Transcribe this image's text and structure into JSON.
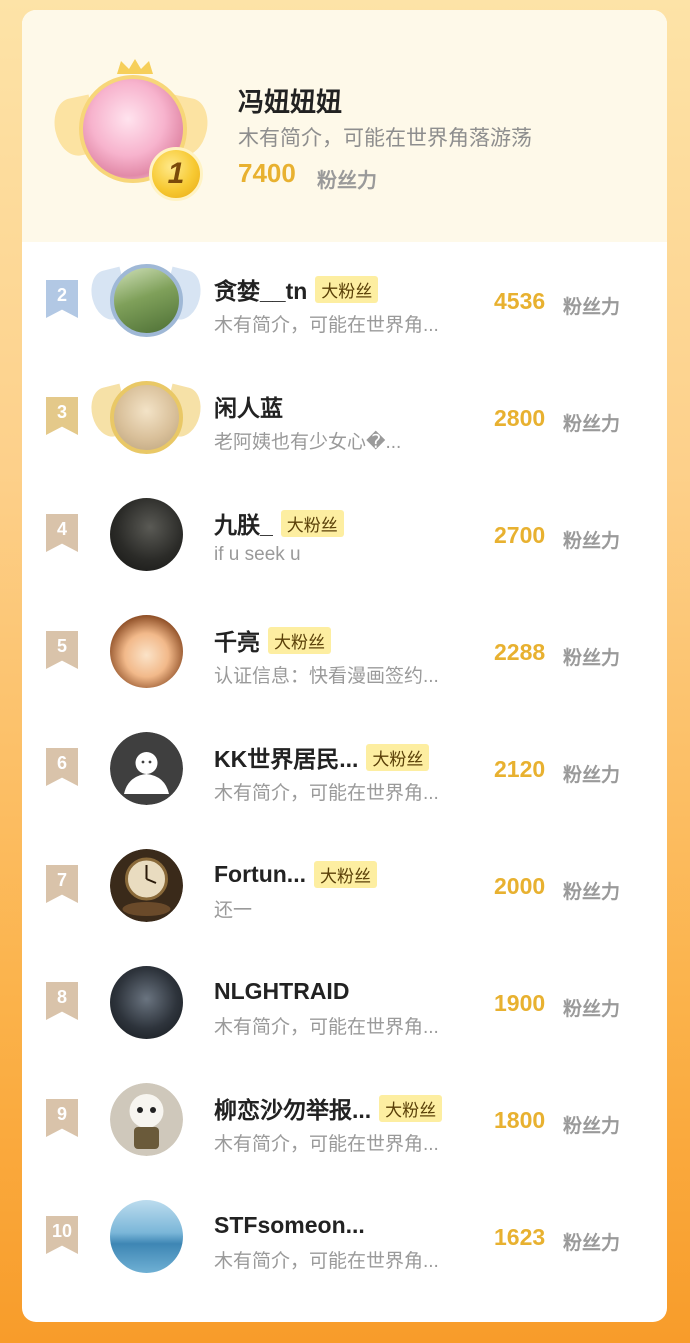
{
  "top": {
    "rank": "1",
    "name": "冯妞妞妞",
    "bio": "木有简介，可能在世界角落游荡",
    "score": "7400",
    "unit": "粉丝力"
  },
  "badge_label": "大粉丝",
  "unit": "粉丝力",
  "rows": [
    {
      "rank": "2",
      "name": "贪婪__tn",
      "badge": "大粉丝",
      "bio": "木有简介，可能在世界角...",
      "score": "4536"
    },
    {
      "rank": "3",
      "name": "闲人蓝",
      "badge": "",
      "bio": "老阿姨也有少女心�...",
      "score": "2800"
    },
    {
      "rank": "4",
      "name": "九朕_",
      "badge": "大粉丝",
      "bio": "if u seek u",
      "score": "2700"
    },
    {
      "rank": "5",
      "name": "千亮",
      "badge": "大粉丝",
      "bio": "认证信息：快看漫画签约...",
      "score": "2288"
    },
    {
      "rank": "6",
      "name": "KK世界居民...",
      "badge": "大粉丝",
      "bio": "木有简介，可能在世界角...",
      "score": "2120"
    },
    {
      "rank": "7",
      "name": "Fortun...",
      "badge": "大粉丝",
      "bio": "还一",
      "score": "2000"
    },
    {
      "rank": "8",
      "name": "NLGHTRAID",
      "badge": "",
      "bio": "木有简介，可能在世界角...",
      "score": "1900"
    },
    {
      "rank": "9",
      "name": "柳恋沙勿举报...",
      "badge": "大粉丝",
      "bio": "木有简介，可能在世界角...",
      "score": "1800"
    },
    {
      "rank": "10",
      "name": "STFsomeon...",
      "badge": "",
      "bio": "木有简介，可能在世界角...",
      "score": "1623"
    }
  ],
  "colors": {
    "score": "#e8b130",
    "badge_bg": "#fdeea1",
    "silver": "#b2c8e4",
    "gold": "#e4c98a"
  }
}
